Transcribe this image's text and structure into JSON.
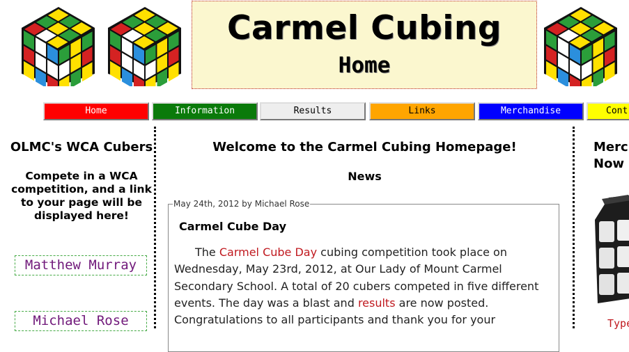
{
  "header": {
    "site_title": "Carmel Cubing",
    "page_subtitle": "Home"
  },
  "nav": {
    "items": [
      {
        "label": "Home",
        "bg": "#ff0000",
        "fg": "#ffffff"
      },
      {
        "label": "Information",
        "bg": "#0a7a0a",
        "fg": "#ffffff"
      },
      {
        "label": "Results",
        "bg": "#eeeeee",
        "fg": "#000000"
      },
      {
        "label": "Links",
        "bg": "#ffa500",
        "fg": "#000000"
      },
      {
        "label": "Merchandise",
        "bg": "#0000ff",
        "fg": "#ffffff"
      },
      {
        "label": "Cont",
        "bg": "#ffff00",
        "fg": "#000000"
      }
    ]
  },
  "left": {
    "title": "OLMC's WCA Cubers",
    "blurb": "Compete in a WCA competition, and a link to your page will be displayed here!",
    "members": [
      "Matthew Murray",
      "Michael Rose"
    ]
  },
  "main": {
    "heading": "Welcome to the Carmel Cubing Homepage!",
    "news_heading": "News",
    "post": {
      "legend": "May 24th, 2012 by Michael Rose",
      "title": "Carmel Cube Day",
      "text_1": "The ",
      "link_1": "Carmel Cube Day",
      "text_2": " cubing competition took place on Wednesday, May 23rd, 2012, at Our Lady of Mount Carmel Secondary School. A total of 20 cubers competed in five different events. The day was a blast and ",
      "link_2": "results",
      "text_3": " are now posted. Congratulations to all participants and thank you for your"
    }
  },
  "right": {
    "title": "Merch Now",
    "link": "Type"
  },
  "icons": [
    "rubiks-cube-icon",
    "cube-photo"
  ]
}
